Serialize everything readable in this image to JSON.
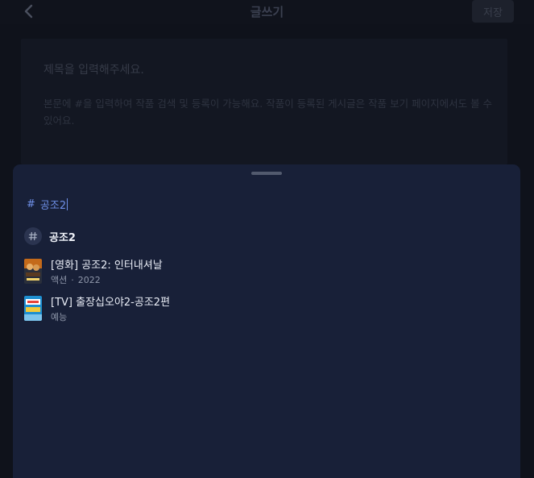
{
  "header": {
    "title": "글쓰기",
    "save_label": "저장"
  },
  "editor": {
    "title_placeholder": "제목을 입력해주세요.",
    "body_placeholder": "본문에 #을 입력하여 작품 검색 및 등록이 가능해요. 작품이 등록된 게시글은 작품 보기 페이지에서도 볼 수 있어요."
  },
  "sheet": {
    "query_hash": "#",
    "query_text": "공조2",
    "tag_suggestion": {
      "hash_glyph": "#",
      "label": "공조2"
    },
    "results": [
      {
        "title": "[영화] 공조2: 인터내셔날",
        "genre": "액션",
        "separator": "·",
        "year": "2022",
        "poster_colors": [
          "#c46a1a",
          "#2a2f3b"
        ]
      },
      {
        "title": "[TV] 출장십오야2-공조2편",
        "genre": "예능",
        "poster_colors": [
          "#1e8fd0",
          "#f0c93a"
        ]
      }
    ]
  },
  "colors": {
    "accent": "#6f90e8",
    "sheet_bg": "#182038",
    "page_bg": "#0f121b"
  }
}
